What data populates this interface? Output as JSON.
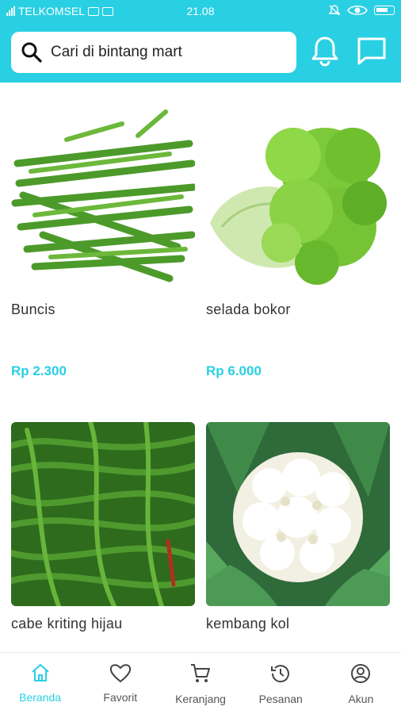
{
  "status_bar": {
    "carrier": "TELKOMSEL",
    "time": "21.08"
  },
  "search": {
    "placeholder": "Cari di bintang mart"
  },
  "header_icons": [
    "bell-icon",
    "chat-icon"
  ],
  "products": [
    {
      "name": "Buncis",
      "price": "Rp 2.300",
      "image": "green-beans"
    },
    {
      "name": "selada bokor",
      "price": "Rp 6.000",
      "image": "lettuce"
    },
    {
      "name": "cabe kriting hijau",
      "price": "",
      "image": "green-chili"
    },
    {
      "name": "kembang kol",
      "price": "",
      "image": "cauliflower"
    }
  ],
  "bottom_nav": [
    {
      "label": "Beranda",
      "icon": "home-icon",
      "active": true
    },
    {
      "label": "Favorit",
      "icon": "heart-icon",
      "active": false
    },
    {
      "label": "Keranjang",
      "icon": "cart-icon",
      "active": false
    },
    {
      "label": "Pesanan",
      "icon": "history-icon",
      "active": false
    },
    {
      "label": "Akun",
      "icon": "account-icon",
      "active": false
    }
  ],
  "colors": {
    "accent": "#29cfe3",
    "text": "#333333"
  }
}
